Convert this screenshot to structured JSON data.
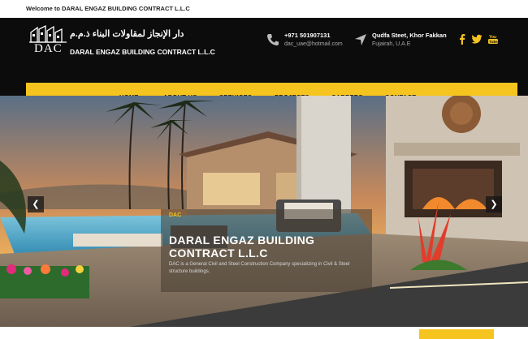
{
  "topbar": {
    "welcome": "Welcome to DARAL ENGAZ BUILDING CONTRACT L.L.C"
  },
  "logo": {
    "abbr": "DAC",
    "arabic": "دار الإنجاز لمقاولات البناء ذ.م.م",
    "english": "DARAL ENGAZ BUILDING CONTRACT L.L.C"
  },
  "contact": {
    "phone": "+971 501907131",
    "email": "dac_uae@hotmail.com",
    "street": "Qudfa Steet, Khor Fakkan",
    "city": "Fujairah, U.A.E"
  },
  "social": {
    "icons": [
      "facebook-icon",
      "twitter-icon",
      "youtube-icon"
    ]
  },
  "nav": {
    "home": "HOME",
    "about": "ABOUT US",
    "services": "SERVICES",
    "projects": "PROJECTS",
    "careers": "CAREERS",
    "contact": "CONTACT"
  },
  "slider": {
    "prev": "❮",
    "next": "❯",
    "tag": "DAC",
    "title": "DARAL ENGAZ BUILDING CONTRACT L.L.C",
    "desc": "DAC is a General Civil and Steel Construction Company specializing in Civil & Steel structure buildings."
  },
  "colors": {
    "accent": "#f5c41f",
    "header": "#0c0c0c"
  }
}
